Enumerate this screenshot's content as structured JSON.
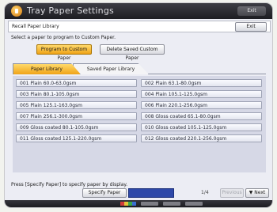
{
  "window": {
    "title": "Tray Paper Settings",
    "exit_label": "Exit"
  },
  "header": {
    "label": "Recall Paper Library",
    "exit_label": "Exit"
  },
  "instruction": "Select a paper to program to Custom Paper.",
  "actions": {
    "program_label": "Program to Custom Paper",
    "delete_label": "Delete Saved Custom Paper"
  },
  "tabs": [
    {
      "label": "Paper Library",
      "active": true
    },
    {
      "label": "Saved Paper Library",
      "active": false
    }
  ],
  "papers": [
    "001 Plain 60.0-63.0gsm",
    "002 Plain 63.1-80.0gsm",
    "003 Plain 80.1-105.0gsm",
    "004 Plain 105.1-125.0gsm",
    "005 Plain 125.1-163.0gsm",
    "006 Plain 220.1-256.0gsm",
    "007 Plain 256.1-300.0gsm",
    "008 Gloss coated 65.1-80.0gsm",
    "009 Gloss coated 80.1-105.0gsm",
    "010 Gloss coated 105.1-125.0gsm",
    "011 Gloss coated 125.1-220.0gsm",
    "012 Gloss coated 220.1-256.0gsm"
  ],
  "hint": "Press [Specify Paper] to specify paper by display.",
  "footer": {
    "specify_label": "Specify Paper",
    "page_indicator": "1/4",
    "previous_label": "Previous",
    "next_label": "Next",
    "next_icon": "triangle-down-icon"
  },
  "colors": {
    "accent": "#f0a418",
    "title_bar": "#2a2a30",
    "specify_field": "#2e48a8"
  }
}
